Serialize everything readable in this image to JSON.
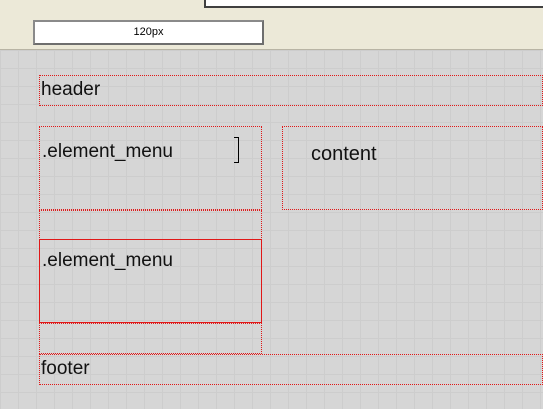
{
  "ruler": {
    "width_label": "120px"
  },
  "layout": {
    "header_label": "header",
    "menu1_label": ".element_menu",
    "content_label": "content",
    "menu2_label": ".element_menu",
    "footer_label": "footer"
  },
  "colors": {
    "canvas": "#d6d6d6",
    "toolbar": "#ece9d8",
    "outline": "#e01818"
  }
}
